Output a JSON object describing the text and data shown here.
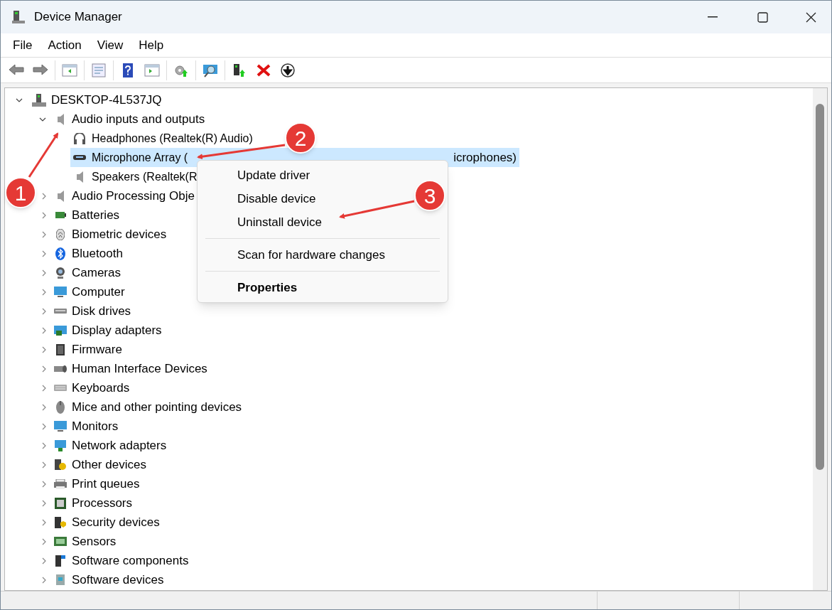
{
  "window": {
    "title": "Device Manager"
  },
  "menu_bar": [
    "File",
    "Action",
    "View",
    "Help"
  ],
  "tree": {
    "label": "DESKTOP-4L537JQ",
    "expanded": true,
    "children": [
      {
        "label": "Audio inputs and outputs",
        "expanded": true,
        "children": [
          {
            "label": "Headphones (Realtek(R) Audio)",
            "selected": false
          },
          {
            "label": "Microphone Array (",
            "label_tail": "icrophones)",
            "selected": true
          },
          {
            "label": "Speakers (Realtek(R",
            "selected": false
          }
        ]
      },
      {
        "label": "Audio Processing Obje",
        "expanded": false
      },
      {
        "label": "Batteries",
        "expanded": false
      },
      {
        "label": "Biometric devices",
        "expanded": false
      },
      {
        "label": "Bluetooth",
        "expanded": false
      },
      {
        "label": "Cameras",
        "expanded": false
      },
      {
        "label": "Computer",
        "expanded": false
      },
      {
        "label": "Disk drives",
        "expanded": false
      },
      {
        "label": "Display adapters",
        "expanded": false
      },
      {
        "label": "Firmware",
        "expanded": false
      },
      {
        "label": "Human Interface Devices",
        "expanded": false
      },
      {
        "label": "Keyboards",
        "expanded": false
      },
      {
        "label": "Mice and other pointing devices",
        "expanded": false
      },
      {
        "label": "Monitors",
        "expanded": false
      },
      {
        "label": "Network adapters",
        "expanded": false
      },
      {
        "label": "Other devices",
        "expanded": false
      },
      {
        "label": "Print queues",
        "expanded": false
      },
      {
        "label": "Processors",
        "expanded": false
      },
      {
        "label": "Security devices",
        "expanded": false
      },
      {
        "label": "Sensors",
        "expanded": false
      },
      {
        "label": "Software components",
        "expanded": false
      },
      {
        "label": "Software devices",
        "expanded": false
      }
    ]
  },
  "context_menu": [
    {
      "kind": "item",
      "label": "Update driver"
    },
    {
      "kind": "item",
      "label": "Disable device"
    },
    {
      "kind": "item",
      "label": "Uninstall device"
    },
    {
      "kind": "separator"
    },
    {
      "kind": "item",
      "label": "Scan for hardware changes"
    },
    {
      "kind": "separator"
    },
    {
      "kind": "default",
      "label": "Properties"
    }
  ],
  "annotations": [
    {
      "number": "1"
    },
    {
      "number": "2"
    },
    {
      "number": "3"
    }
  ]
}
